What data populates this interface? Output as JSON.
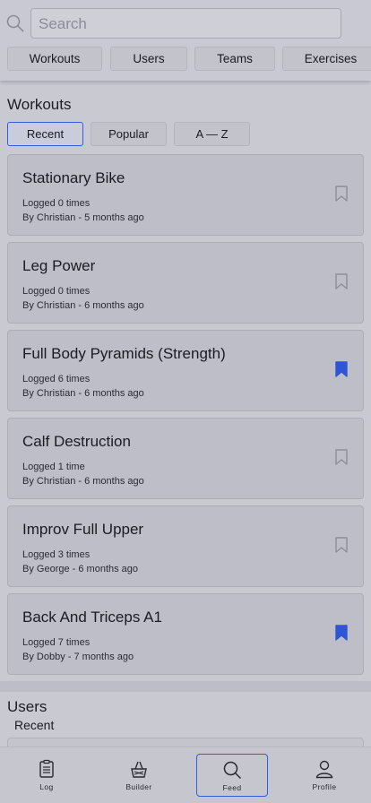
{
  "search": {
    "placeholder": "Search"
  },
  "categories": [
    "Workouts",
    "Users",
    "Teams",
    "Exercises"
  ],
  "workouts": {
    "title": "Workouts",
    "sort_options": [
      "Recent",
      "Popular",
      "A — Z"
    ],
    "active_sort": "Recent",
    "items": [
      {
        "title": "Stationary Bike",
        "logged": "Logged 0 times",
        "by_prefix": "By",
        "author": "Christian",
        "age": " - 5 months ago",
        "bookmarked": false
      },
      {
        "title": "Leg Power",
        "logged": "Logged 0 times",
        "by_prefix": "By",
        "author": "Christian",
        "age": " - 6 months ago",
        "bookmarked": false
      },
      {
        "title": "Full Body Pyramids (Strength)",
        "logged": "Logged 6 times",
        "by_prefix": "By",
        "author": "Christian",
        "age": " - 6 months ago",
        "bookmarked": true
      },
      {
        "title": "Calf Destruction",
        "logged": "Logged 1 time",
        "by_prefix": "By",
        "author": "Christian",
        "age": " - 6 months ago",
        "bookmarked": false
      },
      {
        "title": "Improv Full Upper",
        "logged": "Logged 3 times",
        "by_prefix": "By",
        "author": "George",
        "age": " - 6 months ago",
        "bookmarked": false
      },
      {
        "title": "Back And Triceps A1",
        "logged": "Logged 7 times",
        "by_prefix": "By",
        "author": "Dobby",
        "age": " - 7 months ago",
        "bookmarked": true
      }
    ]
  },
  "users": {
    "title": "Users",
    "subtitle": "Recent"
  },
  "tabbar": {
    "active": "Feed",
    "items": [
      {
        "label": "Log",
        "icon": "clipboard-icon"
      },
      {
        "label": "Builder",
        "icon": "builder-icon"
      },
      {
        "label": "Feed",
        "icon": "search-icon"
      },
      {
        "label": "Profile",
        "icon": "person-icon"
      }
    ]
  },
  "colors": {
    "accent": "#3a5bd8",
    "bookmark_filled": "#2f55d4",
    "bookmark_empty": "#8e8e98",
    "background": "#c9c9d2"
  }
}
